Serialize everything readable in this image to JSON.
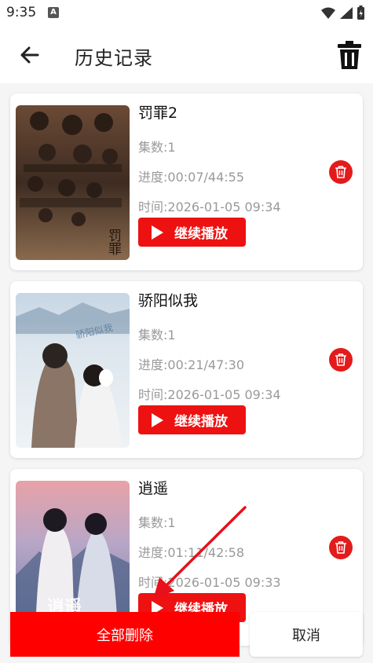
{
  "status_bar": {
    "time": "9:35",
    "notification_badge": "A"
  },
  "header": {
    "title": "历史记录",
    "back_icon": "arrow-left-icon",
    "trash_icon": "trash-icon"
  },
  "history": [
    {
      "title": "罚罪2",
      "episodes": "集数:1",
      "progress": "进度:00:07/44:55",
      "time": "时间:2026-01-05 09:34",
      "play_label": "继续播放",
      "poster_caption": "罚罪"
    },
    {
      "title": "骄阳似我",
      "episodes": "集数:1",
      "progress": "进度:00:21/47:30",
      "time": "时间:2026-01-05 09:34",
      "play_label": "继续播放",
      "poster_caption": "骄阳似我"
    },
    {
      "title": "逍遥",
      "episodes": "集数:1",
      "progress": "进度:01:11/42:58",
      "time": "时间:2026-01-05 09:33",
      "play_label": "继续播放",
      "poster_caption": "逍遥"
    }
  ],
  "actions": {
    "delete_all": "全部删除",
    "cancel": "取消"
  },
  "colors": {
    "accent": "#ee1111",
    "delete_all_bg": "#ff0000",
    "annotation_arrow": "#e8101a"
  }
}
